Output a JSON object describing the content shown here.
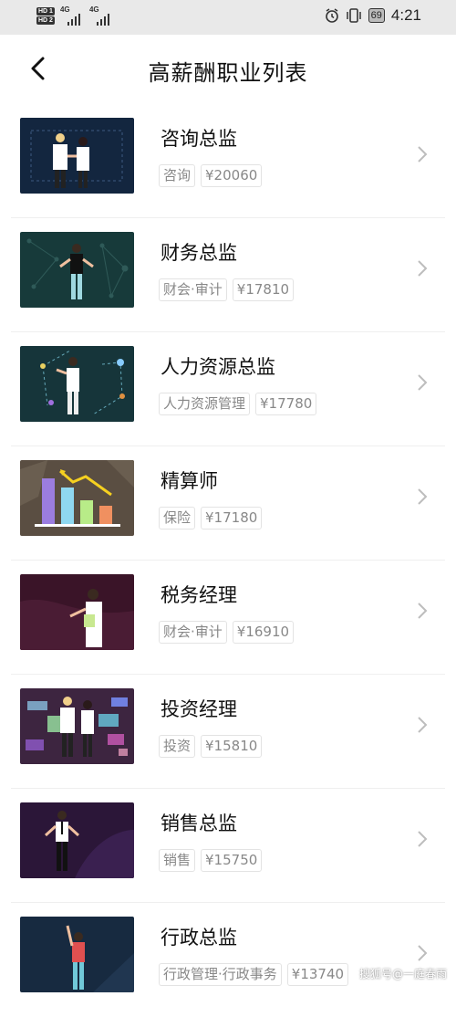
{
  "status_bar": {
    "network_badges": [
      "HD 1",
      "HD 2"
    ],
    "signal_labels": [
      "4G",
      "4G"
    ],
    "battery": "69",
    "time": "4:21"
  },
  "header": {
    "title": "高薪酬职业列表"
  },
  "jobs": [
    {
      "title": "咨询总监",
      "tags": [
        "咨询",
        "¥20060"
      ],
      "thumb_bg": "#13263f"
    },
    {
      "title": "财务总监",
      "tags": [
        "财会·审计",
        "¥17810"
      ],
      "thumb_bg": "#173a3a"
    },
    {
      "title": "人力资源总监",
      "tags": [
        "人力资源管理",
        "¥17780"
      ],
      "thumb_bg": "#16353a"
    },
    {
      "title": "精算师",
      "tags": [
        "保险",
        "¥17180"
      ],
      "thumb_bg": "#5a4e42"
    },
    {
      "title": "税务经理",
      "tags": [
        "财会·审计",
        "¥16910"
      ],
      "thumb_bg": "#3a1428"
    },
    {
      "title": "投资经理",
      "tags": [
        "投资",
        "¥15810"
      ],
      "thumb_bg": "#3d2540"
    },
    {
      "title": "销售总监",
      "tags": [
        "销售",
        "¥15750"
      ],
      "thumb_bg": "#2b1638"
    },
    {
      "title": "行政总监",
      "tags": [
        "行政管理·行政事务",
        "¥13740"
      ],
      "thumb_bg": "#172a40"
    }
  ],
  "watermark": "搜狐号@一庭春雨"
}
